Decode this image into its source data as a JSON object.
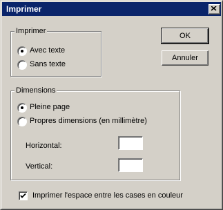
{
  "window": {
    "title": "Imprimer"
  },
  "buttons": {
    "ok": "OK",
    "cancel": "Annuler"
  },
  "group_print": {
    "legend": "Imprimer",
    "options": [
      {
        "label": "Avec texte",
        "selected": true
      },
      {
        "label": "Sans texte",
        "selected": false
      }
    ]
  },
  "group_dimensions": {
    "legend": "Dimensions",
    "options": [
      {
        "label": "Pleine page",
        "selected": true
      },
      {
        "label": "Propres dimensions (en millimètre)",
        "selected": false
      }
    ],
    "horizontal_label": "Horizontal:",
    "horizontal_value": "",
    "vertical_label": "Vertical:",
    "vertical_value": ""
  },
  "checkbox": {
    "label": "Imprimer l'espace entre les cases en couleur",
    "checked": true
  }
}
